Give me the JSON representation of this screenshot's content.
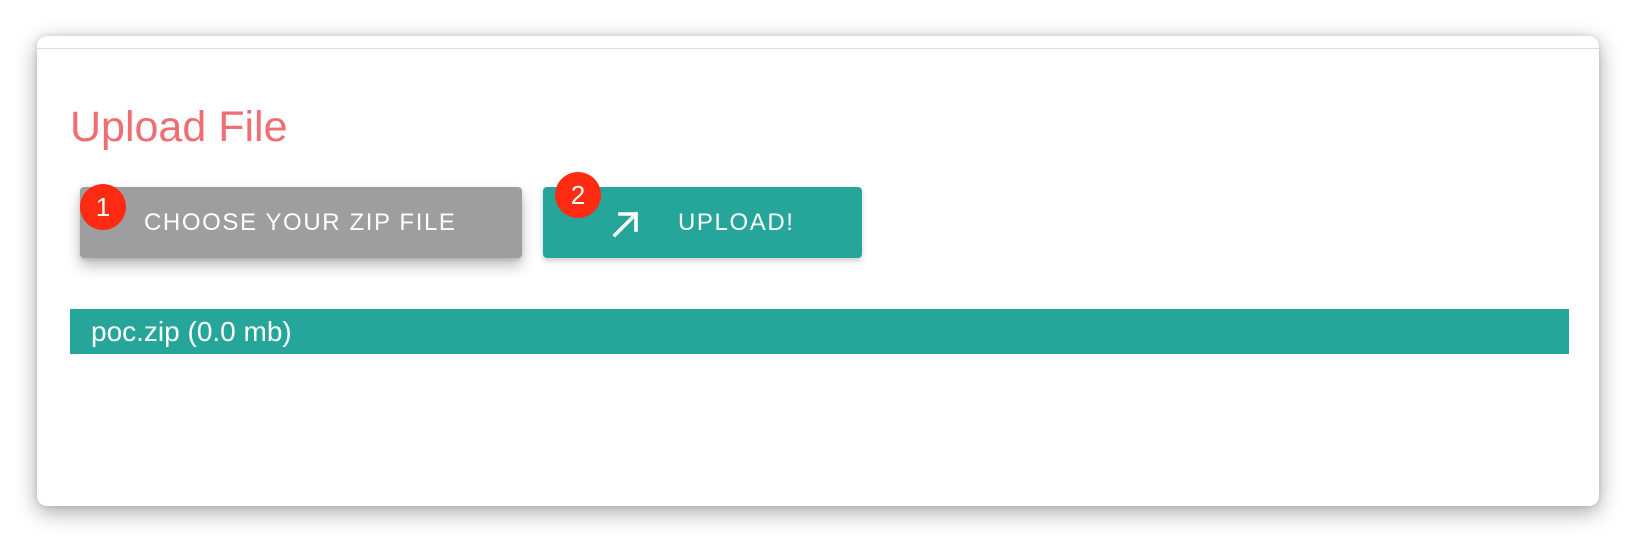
{
  "upload_panel": {
    "title": "Upload File",
    "choose_button": {
      "label": "CHOOSE YOUR ZIP FILE",
      "step": "1"
    },
    "upload_button": {
      "label": "UPLOAD!",
      "icon": "arrow-up-right-icon",
      "step": "2"
    },
    "selected_file": {
      "text": "poc.zip (0.0 mb)"
    }
  },
  "colors": {
    "title": "#ee6e73",
    "choose_button": "#9e9e9e",
    "accent": "#26a69a",
    "step_badge": "#ff2a12"
  }
}
